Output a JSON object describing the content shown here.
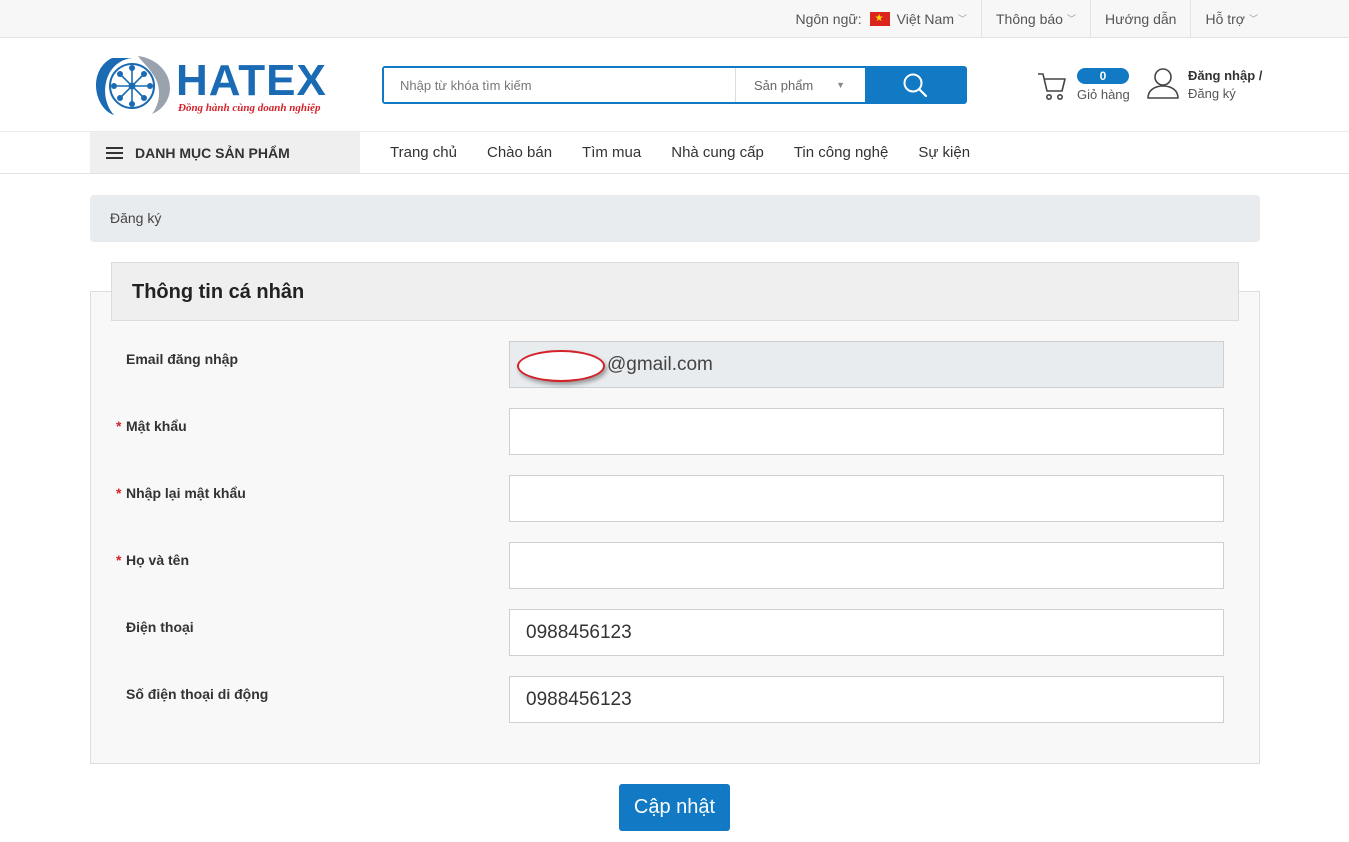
{
  "topbar": {
    "language_label": "Ngôn ngữ:",
    "language_value": "Việt Nam",
    "notifications": "Thông báo",
    "guide": "Hướng dẫn",
    "support": "Hỗ trợ"
  },
  "logo": {
    "name": "HATEX",
    "tagline": "Đồng hành cùng doanh nghiệp"
  },
  "search": {
    "placeholder": "Nhập từ khóa tìm kiếm",
    "category": "Sản phẩm"
  },
  "cart": {
    "count": "0",
    "label": "Giỏ hàng"
  },
  "account": {
    "login": "Đăng nhập /",
    "register": "Đăng ký"
  },
  "nav": {
    "category_menu": "DANH MỤC SẢN PHẨM",
    "items": [
      "Trang chủ",
      "Chào bán",
      "Tìm mua",
      "Nhà cung cấp",
      "Tin công nghệ",
      "Sự kiện"
    ]
  },
  "breadcrumb": "Đăng ký",
  "form": {
    "section_title": "Thông tin cá nhân",
    "email_label": "Email đăng nhập",
    "email_value": "@gmail.com",
    "password_label": "Mật khẩu",
    "password_value": "",
    "confirm_label": "Nhập lại mật khẩu",
    "confirm_value": "",
    "fullname_label": "Họ và tên",
    "fullname_value": "",
    "phone_label": "Điện thoại",
    "phone_value": "0988456123",
    "mobile_label": "Số điện thoại di động",
    "mobile_value": "0988456123",
    "required_mark": "*",
    "submit": "Cập nhật"
  },
  "colors": {
    "brand_blue": "#1279c4",
    "accent_red": "#d2232a"
  }
}
